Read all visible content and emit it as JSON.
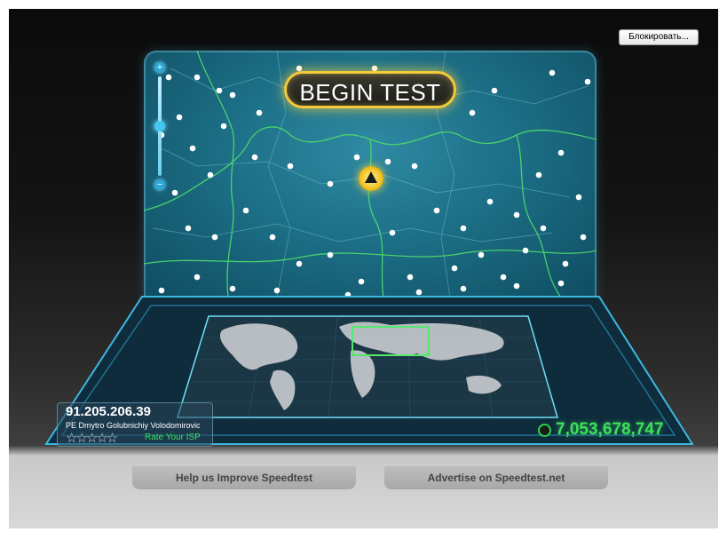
{
  "block_button": {
    "label": "Блокировать..."
  },
  "begin_test": {
    "label": "BEGIN TEST"
  },
  "connection": {
    "ip": "91.205.206.39",
    "isp": "PE Dmytro Golubnichiy Volodomirovic",
    "rating_stars": "☆☆☆☆☆",
    "rate_label": "Rate Your ISP"
  },
  "tests_counter": "7,053,678,747",
  "bottom_tabs": {
    "help": "Help us Improve Speedtest",
    "advertise": "Advertise on Speedtest.net"
  },
  "icons": {
    "zoom_in": "plus-icon",
    "zoom_out": "minus-icon",
    "server": "triangle-icon",
    "counter": "globe-icon"
  },
  "colors": {
    "accent_gold": "#f4c93a",
    "counter_green": "#3ee05b",
    "map_teal": "#1c6f86",
    "server_dot": "#ffffff",
    "border_green": "#52e36a"
  }
}
